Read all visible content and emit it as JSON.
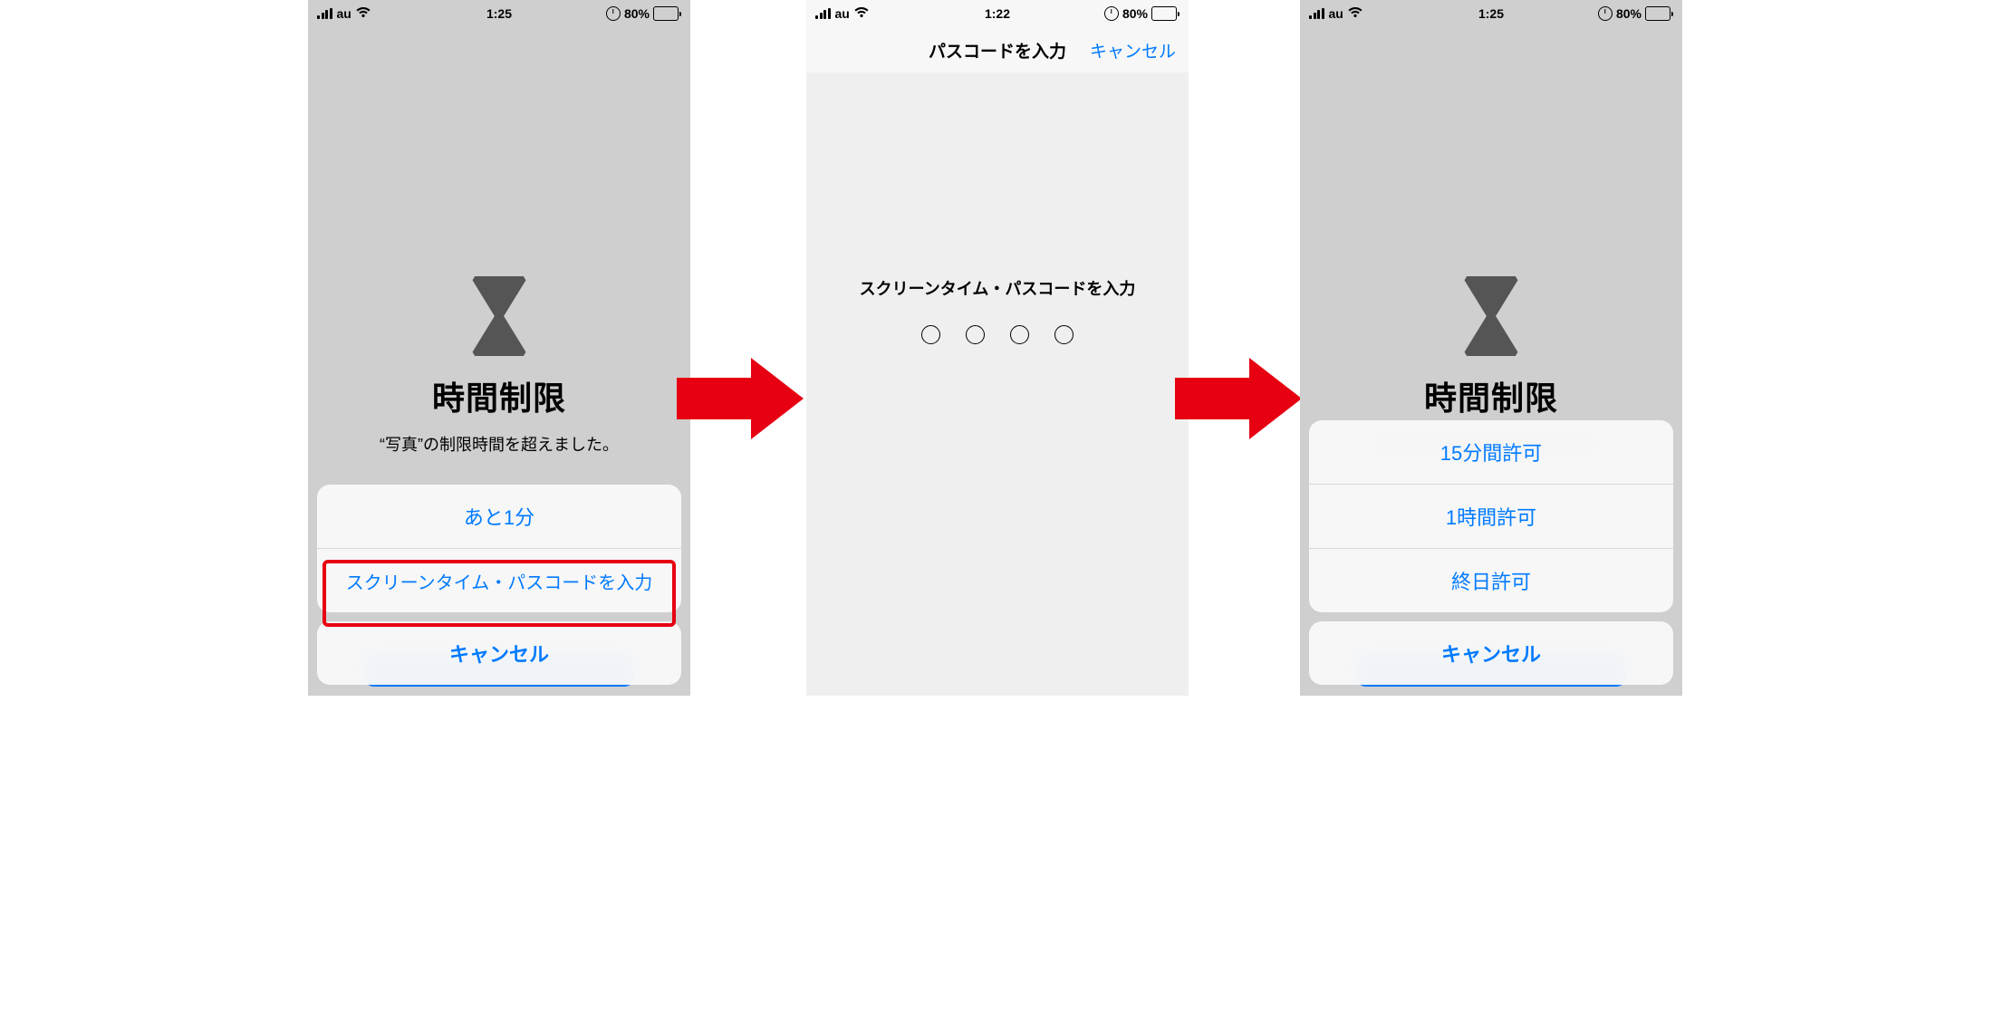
{
  "status": {
    "carrier": "au",
    "time_a": "1:25",
    "time_b": "1:22",
    "battery_pct": "80%"
  },
  "limit_screen": {
    "title": "時間制限",
    "subtitle": "“写真”の制限時間を超えました。"
  },
  "sheet_a": {
    "item1": "あと1分",
    "item2": "スクリーンタイム・パスコードを入力",
    "cancel": "キャンセル"
  },
  "passcode_screen": {
    "nav_title": "パスコードを入力",
    "nav_cancel": "キャンセル",
    "prompt": "スクリーンタイム・パスコードを入力"
  },
  "sheet_b": {
    "item1": "15分間許可",
    "item2": "1時間許可",
    "item3": "終日許可",
    "cancel": "キャンセル"
  },
  "arrow_color": "#e60012"
}
